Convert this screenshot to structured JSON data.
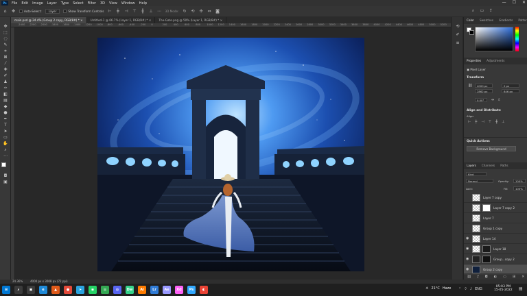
{
  "menubar": {
    "logo": "Ps",
    "items": [
      "File",
      "Edit",
      "Image",
      "Layer",
      "Type",
      "Select",
      "Filter",
      "3D",
      "View",
      "Window",
      "Help"
    ],
    "win_controls": [
      "—",
      "☐",
      "✕"
    ]
  },
  "options": {
    "auto_select_label": "Auto-Select:",
    "auto_select_value": "Layer",
    "show_transform_label": "Show Transform Controls",
    "mode_label": "3D Mode:"
  },
  "tabs": [
    {
      "label": "main.psd @ 24.4% (Group 2 copy, RGB/8#) *  ×",
      "active": true
    },
    {
      "label": "Untitled-1 @ 66.7% (Layer 1, RGB/8#) *  ×",
      "active": false
    },
    {
      "label": "The-Gate.png @ 50% (Layer 1, RGB/8#) *  ×",
      "active": false
    }
  ],
  "ruler_ticks": [
    "-2400",
    "-2200",
    "-2000",
    "-1800",
    "-1600",
    "-1400",
    "-1200",
    "-1000",
    "-800",
    "-600",
    "-400",
    "-200",
    "0",
    "200",
    "400",
    "600",
    "800",
    "1000",
    "1200",
    "1400",
    "1600",
    "1800",
    "2000",
    "2200",
    "2400",
    "2600",
    "2800",
    "3000",
    "3200",
    "3400",
    "3600",
    "3800",
    "4000",
    "4200",
    "4400",
    "4600",
    "4800",
    "5000",
    "5200"
  ],
  "color_panel": {
    "tabs": [
      "Color",
      "Swatches",
      "Gradients",
      "Patterns"
    ],
    "hue_color": "#2f6fdc"
  },
  "properties": {
    "tabs": [
      "Properties",
      "Adjustments"
    ],
    "pixel_layer": "Pixel Layer",
    "transform_title": "Transform",
    "w": "4000 px",
    "h": "2862 px",
    "x": "0 px",
    "y": "646 px",
    "angle": "0.00°",
    "align_title": "Align and Distribute",
    "align_label": "Align:",
    "quick_actions_title": "Quick Actions",
    "remove_bg": "Remove Background"
  },
  "layers": {
    "tabs": [
      "Layers",
      "Channels",
      "Paths"
    ],
    "kind": "Kind",
    "blend_mode": "Normal",
    "opacity_label": "Opacity:",
    "opacity": "100%",
    "lock_label": "Lock:",
    "fill_label": "Fill:",
    "fill": "100%",
    "rows": [
      {
        "name": "Layer 7 copy",
        "visible": false,
        "mask": false
      },
      {
        "name": "Layer 7 copy 2",
        "visible": false,
        "mask": true
      },
      {
        "name": "Layer 7",
        "visible": false,
        "mask": false
      },
      {
        "name": "Group 1 copy",
        "visible": false,
        "mask": false
      },
      {
        "name": "Layer 14",
        "visible": true,
        "mask": false
      },
      {
        "name": "Layer 18",
        "visible": true,
        "mask": true
      },
      {
        "name": "Group...copy 2",
        "visible": true,
        "mask": true
      },
      {
        "name": "Group 2 copy",
        "visible": true,
        "mask": false
      }
    ]
  },
  "status": {
    "zoom": "24.36%",
    "doc": "4000 px x 3008 px (72 ppi)"
  },
  "taskbar": {
    "apps": [
      {
        "label": "⌕",
        "color": "#3b3b3b"
      },
      {
        "label": "▣",
        "color": "#3b3b3b"
      },
      {
        "label": "e",
        "color": "#1f8ad8"
      },
      {
        "label": "▲",
        "color": "#e05a1a"
      },
      {
        "label": "●",
        "color": "#e44a3a"
      },
      {
        "label": "➤",
        "color": "#2aa3df"
      },
      {
        "label": "◉",
        "color": "#25d366"
      },
      {
        "label": "◎",
        "color": "#34a853"
      },
      {
        "label": "◍",
        "color": "#5865f2"
      },
      {
        "label": "Dw",
        "color": "#35d28a"
      },
      {
        "label": "Ai",
        "color": "#ff7c00"
      },
      {
        "label": "Lr",
        "color": "#2f7bd6"
      },
      {
        "label": "Ae",
        "color": "#9999ff"
      },
      {
        "label": "Xd",
        "color": "#ff61f6"
      },
      {
        "label": "Ps",
        "color": "#31a8ff"
      },
      {
        "label": "◐",
        "color": "#ea4335"
      }
    ],
    "weather_temp": "21°C",
    "weather_label": "Haze",
    "lang": "ENG",
    "time": "05:03 PM",
    "date": "15-05-2022"
  }
}
